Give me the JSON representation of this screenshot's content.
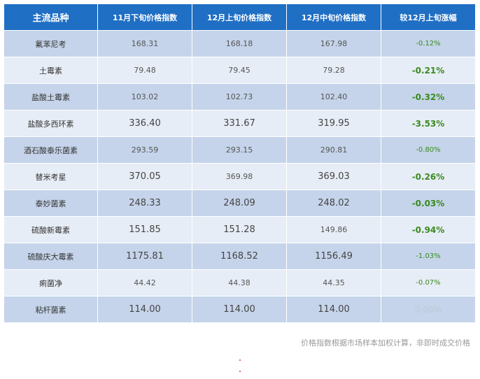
{
  "table": {
    "headers": [
      "主流品种",
      "11月下旬价格指数",
      "12月上旬价格指数",
      "12月中旬价格指数",
      "较12月上旬涨幅"
    ],
    "rows": [
      [
        "氟苯尼考",
        "168.31",
        "168.18",
        "167.98",
        "-0.12%"
      ],
      [
        "土霉素",
        "79.48",
        "79.45",
        "79.28",
        "-0.21%"
      ],
      [
        "盐酸土霉素",
        "103.02",
        "102.73",
        "102.40",
        "-0.32%"
      ],
      [
        "盐酸多西环素",
        "336.40",
        "331.67",
        "319.95",
        "-3.53%"
      ],
      [
        "酒石酸泰乐菌素",
        "293.59",
        "293.15",
        "290.81",
        "-0.80%"
      ],
      [
        "替米考星",
        "370.05",
        "369.98",
        "369.03",
        "-0.26%"
      ],
      [
        "泰妙菌素",
        "248.33",
        "248.09",
        "248.02",
        "-0.03%"
      ],
      [
        "硫酸新霉素",
        "151.85",
        "151.28",
        "149.86",
        "-0.94%"
      ],
      [
        "硫酸庆大霉素",
        "1175.81",
        "1168.52",
        "1156.49",
        "-1.03%"
      ],
      [
        "痢菌净",
        "44.42",
        "44.38",
        "44.35",
        "-0.07%"
      ],
      [
        "粘杆菌素",
        "114.00",
        "114.00",
        "114.00",
        "0.00%"
      ]
    ]
  },
  "footnote": "价格指数根据市场样本加权计算，非即时成交价格",
  "colors": {
    "header": "#1f6fc4",
    "row_dark": "#c5d4ea",
    "row_light": "#e7edf6",
    "change": "#3a8a1e"
  }
}
